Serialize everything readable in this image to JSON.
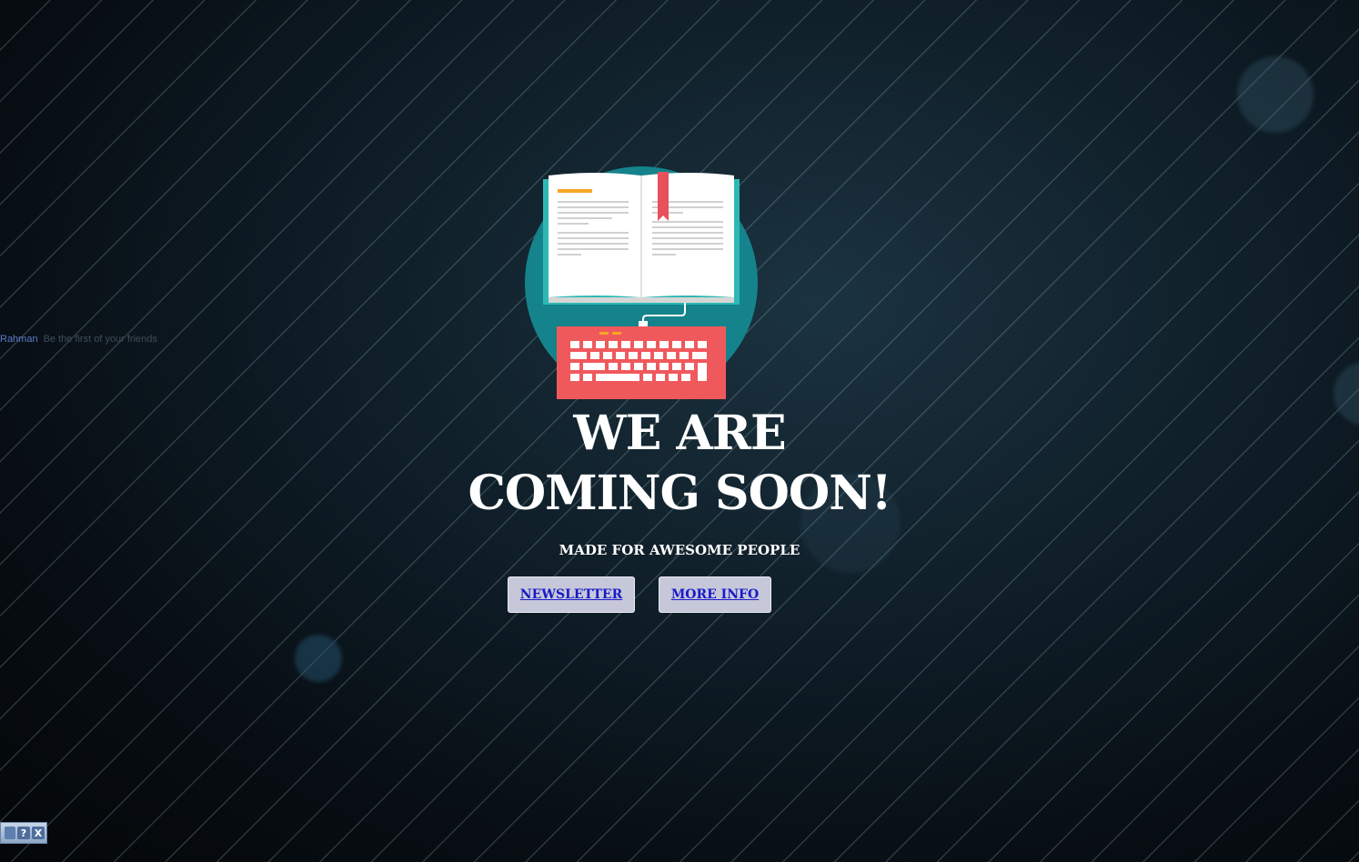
{
  "ticker": {
    "name": "Rahman",
    "text": "Be the first of your friends"
  },
  "hero": {
    "headline_line1": "WE ARE",
    "headline_line2": "COMING SOON!",
    "subheadline": "MADE FOR AWESOME PEOPLE"
  },
  "buttons": {
    "newsletter_label": "NEWSLETTER",
    "more_info_label": "MORE INFO"
  },
  "widget": {
    "help_label": "?",
    "close_label": "X"
  },
  "colors": {
    "illustration_circle": "#14838c",
    "keyboard": "#f0595c",
    "bookmark": "#e8505b",
    "accent_line": "#f5a623",
    "button_text": "#1a1ac8",
    "button_bg": "#c6c8da"
  },
  "icons": {
    "illustration": "book-and-keyboard-icon"
  }
}
